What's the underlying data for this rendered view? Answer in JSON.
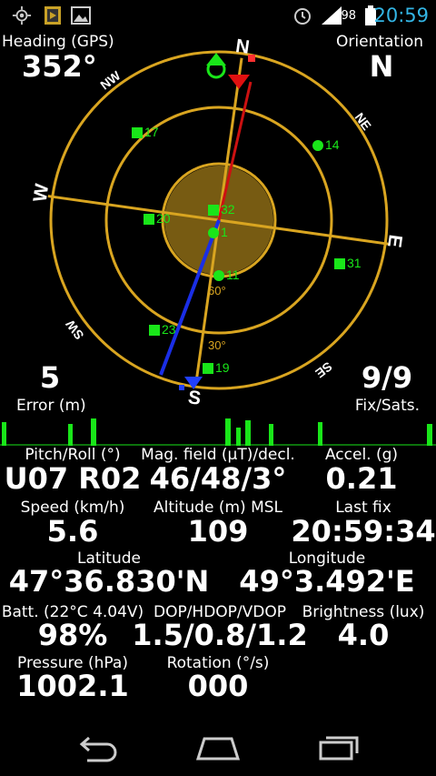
{
  "status_bar": {
    "icons_left": [
      "gps-icon",
      "media-icon",
      "image-icon"
    ],
    "icons_right": [
      "alarm-icon",
      "signal-icon",
      "battery-icon"
    ],
    "battery": "98",
    "time": "20:59"
  },
  "heading": {
    "label": "Heading (GPS)",
    "value": "352°"
  },
  "orientation": {
    "label": "Orientation",
    "value": "N"
  },
  "compass": {
    "north": "N",
    "south": "S",
    "east": "E",
    "west": "W",
    "ne": "NE",
    "nw": "NW",
    "se": "SE",
    "sw": "SW",
    "ring_30": "30°",
    "ring_60": "60°",
    "satellites": [
      {
        "id": "17",
        "shape": "square",
        "color": "#19e619"
      },
      {
        "id": "14",
        "shape": "circle",
        "color": "#19e619"
      },
      {
        "id": "20",
        "shape": "square",
        "color": "#19e619"
      },
      {
        "id": "32",
        "shape": "square",
        "color": "#19e619"
      },
      {
        "id": "1",
        "shape": "circle",
        "color": "#19e619"
      },
      {
        "id": "11",
        "shape": "circle",
        "color": "#19e619"
      },
      {
        "id": "31",
        "shape": "square",
        "color": "#19e619"
      },
      {
        "id": "23",
        "shape": "square",
        "color": "#19e619"
      },
      {
        "id": "19",
        "shape": "square",
        "color": "#19e619"
      }
    ]
  },
  "error": {
    "value": "5",
    "label": "Error (m)"
  },
  "fix": {
    "value": "9/9",
    "label": "Fix/Sats."
  },
  "stats": {
    "pitch_roll": {
      "label": "Pitch/Roll (°)",
      "value": "U07 R02"
    },
    "mag": {
      "label": "Mag. field (µT)/decl.",
      "value": "46/48/3°"
    },
    "accel": {
      "label": "Accel. (g)",
      "value": "0.21"
    },
    "speed": {
      "label": "Speed (km/h)",
      "value": "5.6"
    },
    "altitude": {
      "label": "Altitude (m) MSL",
      "value": "109"
    },
    "lastfix": {
      "label": "Last fix",
      "value": "20:59:34"
    },
    "latitude": {
      "label": "Latitude",
      "value": "47°36.830'N"
    },
    "longitude": {
      "label": "Longitude",
      "value": "49°3.492'E"
    },
    "battery": {
      "label": "Batt. (22°C 4.04V)",
      "value": "98%"
    },
    "dop": {
      "label": "DOP/HDOP/VDOP",
      "value": "1.5/0.8/1.2"
    },
    "brightness": {
      "label": "Brightness (lux)",
      "value": "4.0"
    },
    "pressure": {
      "label": "Pressure (hPa)",
      "value": "1002.1"
    },
    "rotation": {
      "label": "Rotation (°/s)",
      "value": "000"
    }
  },
  "nav": [
    "back-icon",
    "home-icon",
    "recent-apps-icon"
  ],
  "colors": {
    "ring": "#d9a520",
    "accent_blue": "#33b5e5",
    "sat_green": "#19e619"
  }
}
